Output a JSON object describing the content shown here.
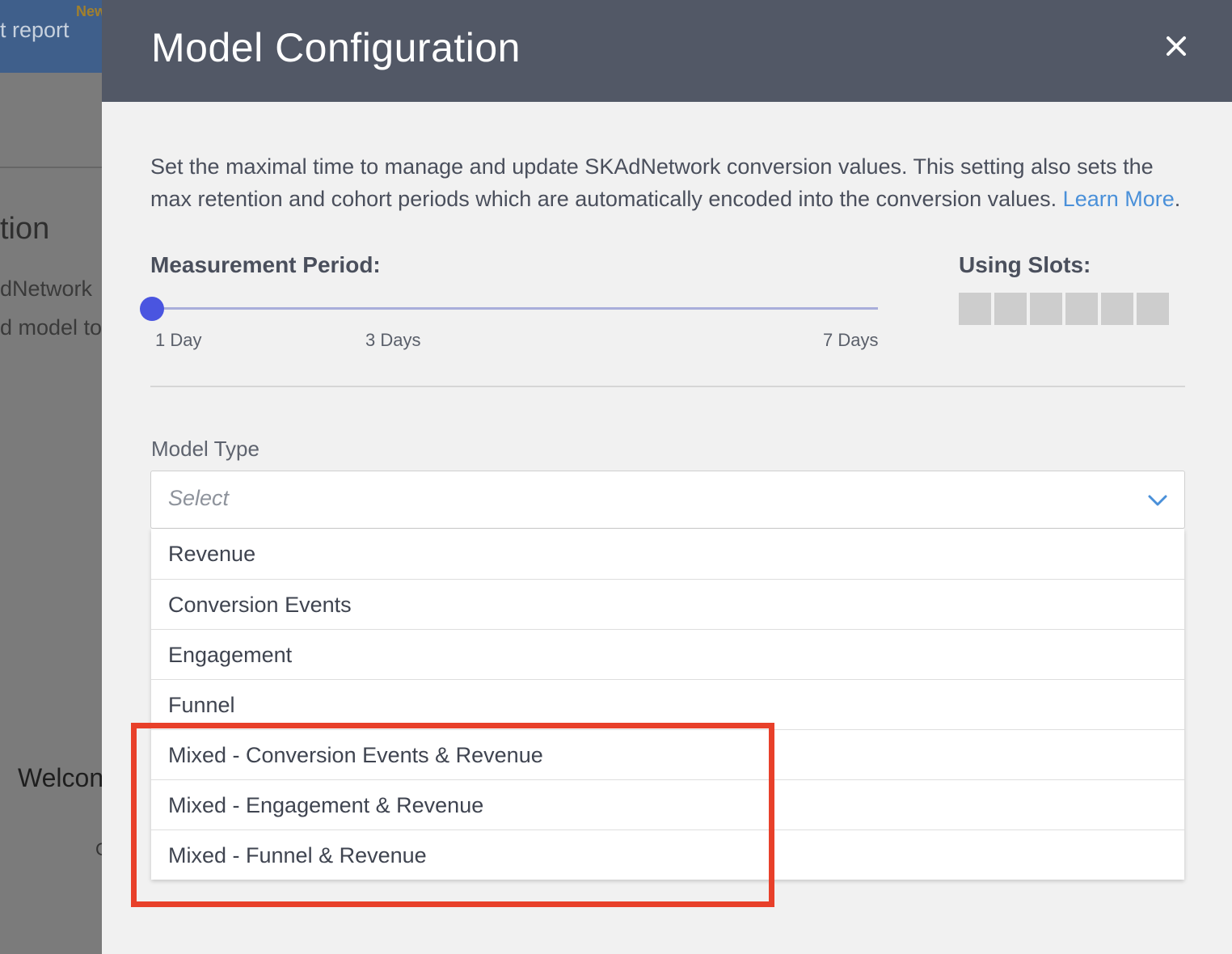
{
  "background": {
    "topbar_text": "t report",
    "topbar_badge": "New",
    "heading": "tion",
    "line1": "dNetwork",
    "line2": "d model to",
    "welcome": "Welcon",
    "small_text": "C"
  },
  "modal": {
    "title": "Model Configuration",
    "description": "Set the maximal time to manage and update SKAdNetwork conversion values. This setting also sets the max retention and cohort periods which are automatically encoded into the conversion values.",
    "learn_more": "Learn More",
    "measurement_period": {
      "label": "Measurement Period:",
      "ticks": [
        "1 Day",
        "3 Days",
        "7 Days"
      ],
      "selected": "1 Day"
    },
    "slots": {
      "label": "Using Slots:",
      "count": 6,
      "used": 0
    },
    "model_type": {
      "label": "Model Type",
      "placeholder": "Select",
      "options": [
        "Revenue",
        "Conversion Events",
        "Engagement",
        "Funnel",
        "Mixed - Conversion Events & Revenue",
        "Mixed - Engagement & Revenue",
        "Mixed - Funnel & Revenue"
      ]
    }
  },
  "colors": {
    "header_bg": "#525866",
    "slider_thumb": "#4a55e0",
    "link": "#4a90d9",
    "highlight": "#e8402a"
  }
}
